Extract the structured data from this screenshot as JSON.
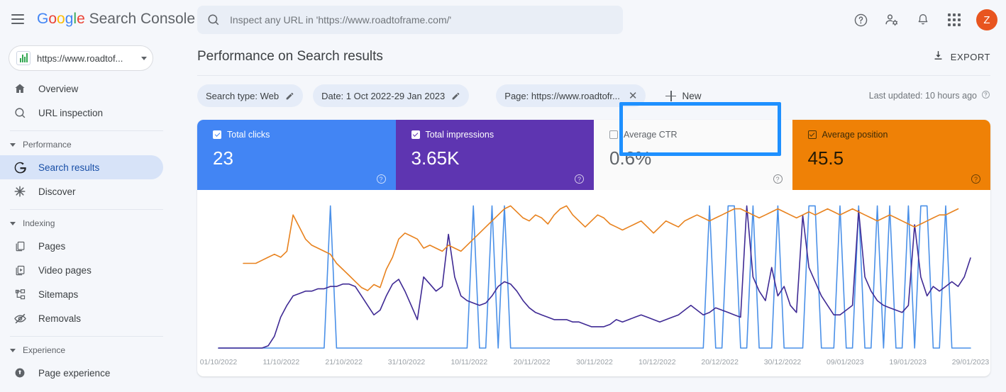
{
  "app": {
    "brand_google": "Google",
    "brand_rest": "Search Console",
    "menu_icon": "hamburger-icon"
  },
  "search": {
    "placeholder": "Inspect any URL in 'https://www.roadtoframe.com/'",
    "icon": "search-icon"
  },
  "topbar": {
    "help_icon": "help-icon",
    "account_settings_icon": "user-settings-icon",
    "notifications_icon": "bell-icon",
    "apps_icon": "apps-grid-icon",
    "avatar_letter": "Z",
    "avatar_color": "#e8551f"
  },
  "sidebar": {
    "property": {
      "label": "https://www.roadtof...",
      "icon": "property-chart-icon"
    },
    "items": [
      {
        "label": "Overview",
        "icon": "home-icon",
        "active": false
      },
      {
        "label": "URL inspection",
        "icon": "search-icon",
        "active": false
      }
    ],
    "groups": [
      {
        "label": "Performance",
        "items": [
          {
            "label": "Search results",
            "icon": "google-g-icon",
            "active": true
          },
          {
            "label": "Discover",
            "icon": "discover-star-icon",
            "active": false
          }
        ]
      },
      {
        "label": "Indexing",
        "items": [
          {
            "label": "Pages",
            "icon": "pages-icon",
            "active": false
          },
          {
            "label": "Video pages",
            "icon": "video-pages-icon",
            "active": false
          },
          {
            "label": "Sitemaps",
            "icon": "sitemaps-icon",
            "active": false
          },
          {
            "label": "Removals",
            "icon": "removals-eye-off-icon",
            "active": false
          }
        ]
      },
      {
        "label": "Experience",
        "items": [
          {
            "label": "Page experience",
            "icon": "page-experience-icon",
            "active": false
          }
        ]
      }
    ]
  },
  "main": {
    "page_title": "Performance on Search results",
    "export_label": "EXPORT",
    "export_icon": "download-icon",
    "last_updated": "Last updated: 10 hours ago",
    "filters": [
      {
        "label": "Search type: Web",
        "editable": true,
        "removable": false
      },
      {
        "label": "Date: 1 Oct 2022-29 Jan 2023",
        "editable": true,
        "removable": false
      },
      {
        "label": "Page: https://www.roadtofr...",
        "editable": false,
        "removable": true,
        "highlighted": true
      }
    ],
    "new_filter_label": "New",
    "annotation": {
      "color": "#1E90FF",
      "target": "page-filter-chip"
    }
  },
  "metrics": [
    {
      "name": "Total clicks",
      "value": "23",
      "checked": true,
      "color": "#4285F4"
    },
    {
      "name": "Total impressions",
      "value": "3.65K",
      "checked": true,
      "color": "#5e35b1"
    },
    {
      "name": "Average CTR",
      "value": "0.6%",
      "checked": false,
      "color": "#fafafa"
    },
    {
      "name": "Average position",
      "value": "45.5",
      "checked": true,
      "color": "#ef8106"
    }
  ],
  "chart_data": {
    "type": "line",
    "title": "Performance on Search results",
    "xlabel": "",
    "ylabel": "",
    "grid": false,
    "legend": "none",
    "x_tick_labels": [
      "01/10/2022",
      "11/10/2022",
      "21/10/2022",
      "31/10/2022",
      "10/11/2022",
      "20/11/2022",
      "30/11/2022",
      "10/12/2022",
      "20/12/2022",
      "30/12/2022",
      "09/01/2023",
      "19/01/2023",
      "29/01/2023"
    ],
    "x_range": [
      "01/10/2022",
      "29/01/2023"
    ],
    "n_points": 122,
    "series": [
      {
        "name": "Total clicks",
        "color": "#4a90e8",
        "total": "23",
        "values": [
          0,
          0,
          0,
          0,
          0,
          0,
          0,
          0,
          0,
          0,
          0,
          0,
          0,
          0,
          0,
          0,
          0,
          0,
          1,
          0,
          0,
          0,
          0,
          0,
          0,
          0,
          0,
          0,
          0,
          0,
          0,
          0,
          0,
          0,
          0,
          0,
          0,
          0,
          0,
          0,
          0,
          1,
          0,
          0,
          1,
          0,
          1,
          0,
          0,
          0,
          0,
          0,
          0,
          0,
          0,
          0,
          0,
          0,
          0,
          0,
          0,
          0,
          0,
          0,
          0,
          0,
          0,
          0,
          0,
          0,
          0,
          0,
          0,
          0,
          0,
          0,
          0,
          0,
          0,
          1,
          0,
          0,
          1,
          1,
          0,
          0,
          1,
          0,
          0,
          0,
          1,
          0,
          0,
          0,
          0,
          1,
          1,
          0,
          0,
          0,
          1,
          0,
          0,
          1,
          0,
          0,
          1,
          0,
          1,
          0,
          0,
          1,
          0,
          1,
          1,
          0,
          0,
          1,
          0,
          0,
          0,
          0
        ]
      },
      {
        "name": "Total impressions",
        "color": "#3f2a94",
        "total": "3.65K",
        "values": [
          0,
          0,
          0,
          0,
          0,
          0,
          0,
          0,
          1,
          5,
          13,
          18,
          22,
          23,
          24,
          24,
          25,
          25,
          26,
          26,
          27,
          27,
          26,
          22,
          18,
          14,
          16,
          22,
          27,
          29,
          24,
          18,
          12,
          30,
          27,
          24,
          26,
          48,
          30,
          22,
          20,
          19,
          18,
          19,
          22,
          26,
          28,
          27,
          24,
          20,
          17,
          15,
          14,
          13,
          12,
          12,
          12,
          11,
          11,
          10,
          9,
          9,
          9,
          10,
          12,
          11,
          12,
          13,
          14,
          13,
          12,
          11,
          12,
          13,
          14,
          16,
          18,
          16,
          14,
          15,
          17,
          16,
          15,
          14,
          13,
          60,
          30,
          24,
          20,
          34,
          22,
          26,
          18,
          15,
          56,
          34,
          28,
          22,
          18,
          14,
          14,
          16,
          18,
          58,
          30,
          24,
          20,
          18,
          17,
          16,
          15,
          18,
          52,
          30,
          22,
          26,
          24,
          26,
          28,
          26,
          30,
          38,
          44
        ]
      },
      {
        "name": "Average position",
        "color": "#e8821e",
        "average": "45.5",
        "values": [
          null,
          null,
          null,
          null,
          28,
          28,
          28,
          29,
          30,
          31,
          30,
          32,
          44,
          40,
          36,
          34,
          33,
          32,
          31,
          28,
          26,
          24,
          22,
          20,
          19,
          21,
          20,
          26,
          30,
          36,
          38,
          37,
          36,
          33,
          34,
          33,
          32,
          34,
          33,
          32,
          34,
          36,
          38,
          40,
          42,
          44,
          46,
          47,
          45,
          43,
          42,
          44,
          43,
          41,
          44,
          46,
          47,
          44,
          42,
          40,
          42,
          44,
          43,
          41,
          40,
          39,
          40,
          41,
          42,
          40,
          38,
          40,
          42,
          41,
          40,
          42,
          43,
          44,
          43,
          42,
          43,
          44,
          45,
          46,
          46,
          45,
          44,
          43,
          44,
          45,
          46,
          45,
          44,
          43,
          44,
          45,
          44,
          45,
          46,
          45,
          44,
          45,
          46,
          45,
          44,
          43,
          42,
          43,
          44,
          43,
          42,
          41,
          40,
          41,
          42,
          43,
          44,
          44,
          45,
          46
        ]
      }
    ]
  }
}
